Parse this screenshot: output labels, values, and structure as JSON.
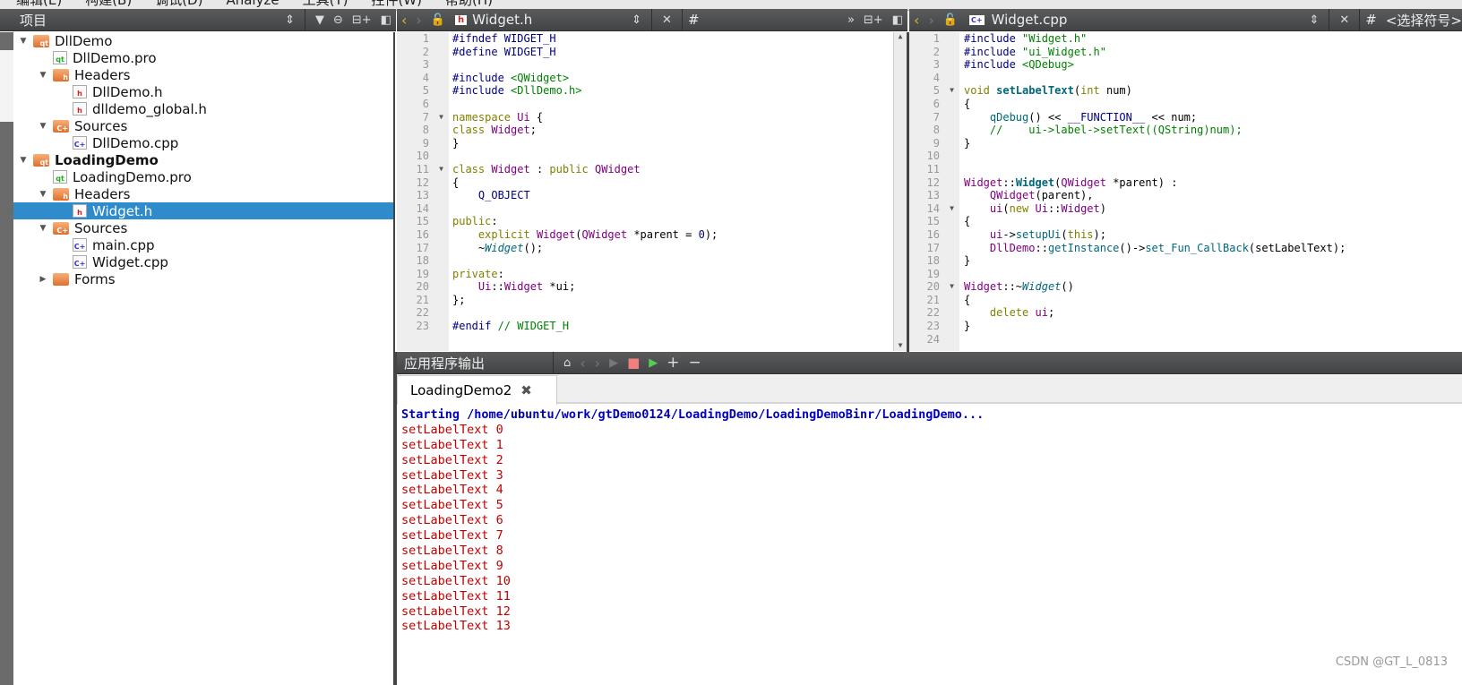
{
  "menu": [
    "编辑(E)",
    "构建(B)",
    "调试(D)",
    "Analyze",
    "工具(T)",
    "控件(W)",
    "帮助(H)"
  ],
  "projects": {
    "title": "项目",
    "tree": [
      {
        "label": "DllDemo",
        "depth": 0,
        "kind": "project",
        "expanded": true,
        "bold": false
      },
      {
        "label": "DllDemo.pro",
        "depth": 1,
        "kind": "pro"
      },
      {
        "label": "Headers",
        "depth": 1,
        "kind": "folder-h",
        "expanded": true
      },
      {
        "label": "DllDemo.h",
        "depth": 2,
        "kind": "h"
      },
      {
        "label": "dlldemo_global.h",
        "depth": 2,
        "kind": "h"
      },
      {
        "label": "Sources",
        "depth": 1,
        "kind": "folder-cpp",
        "expanded": true
      },
      {
        "label": "DllDemo.cpp",
        "depth": 2,
        "kind": "cpp"
      },
      {
        "label": "LoadingDemo",
        "depth": 0,
        "kind": "project",
        "expanded": true,
        "bold": true
      },
      {
        "label": "LoadingDemo.pro",
        "depth": 1,
        "kind": "pro"
      },
      {
        "label": "Headers",
        "depth": 1,
        "kind": "folder-h",
        "expanded": true
      },
      {
        "label": "Widget.h",
        "depth": 2,
        "kind": "h",
        "selected": true
      },
      {
        "label": "Sources",
        "depth": 1,
        "kind": "folder-cpp",
        "expanded": true
      },
      {
        "label": "main.cpp",
        "depth": 2,
        "kind": "cpp"
      },
      {
        "label": "Widget.cpp",
        "depth": 2,
        "kind": "cpp"
      },
      {
        "label": "Forms",
        "depth": 1,
        "kind": "folder-ui",
        "expanded": false
      }
    ]
  },
  "editor_left": {
    "file": "Widget.h",
    "symbol": "#",
    "folds": [
      7,
      11
    ],
    "lines": [
      [
        [
          "p",
          "#ifndef WIDGET_H"
        ]
      ],
      [
        [
          "p",
          "#define WIDGET_H"
        ]
      ],
      [],
      [
        [
          "p",
          "#include "
        ],
        [
          "s",
          "<QWidget>"
        ]
      ],
      [
        [
          "p",
          "#include "
        ],
        [
          "s",
          "<DllDemo.h>"
        ]
      ],
      [],
      [
        [
          "k",
          "namespace "
        ],
        [
          "t",
          "Ui"
        ],
        [
          "n",
          " {"
        ]
      ],
      [
        [
          "k",
          "class "
        ],
        [
          "t",
          "Widget"
        ],
        [
          "n",
          ";"
        ]
      ],
      [
        [
          "n",
          "}"
        ]
      ],
      [],
      [
        [
          "k",
          "class "
        ],
        [
          "t",
          "Widget"
        ],
        [
          "n",
          " : "
        ],
        [
          "k",
          "public "
        ],
        [
          "t",
          "QWidget"
        ]
      ],
      [
        [
          "n",
          "{"
        ]
      ],
      [
        [
          "n",
          "    "
        ],
        [
          "m",
          "Q_OBJECT"
        ]
      ],
      [],
      [
        [
          "k",
          "public"
        ],
        [
          "n",
          ":"
        ]
      ],
      [
        [
          "n",
          "    "
        ],
        [
          "k",
          "explicit "
        ],
        [
          "t",
          "Widget"
        ],
        [
          "n",
          "("
        ],
        [
          "t",
          "QWidget"
        ],
        [
          "n",
          " *parent = "
        ],
        [
          "num",
          "0"
        ],
        [
          "n",
          ");"
        ]
      ],
      [
        [
          "n",
          "    ~"
        ],
        [
          "v",
          "Widget"
        ],
        [
          "n",
          "();"
        ]
      ],
      [],
      [
        [
          "k",
          "private"
        ],
        [
          "n",
          ":"
        ]
      ],
      [
        [
          "n",
          "    "
        ],
        [
          "t",
          "Ui"
        ],
        [
          "n",
          "::"
        ],
        [
          "t",
          "Widget"
        ],
        [
          "n",
          " *ui;"
        ]
      ],
      [
        [
          "n",
          "};"
        ]
      ],
      [],
      [
        [
          "p",
          "#endif "
        ],
        [
          "c",
          "// WIDGET_H"
        ]
      ]
    ]
  },
  "editor_right": {
    "file": "Widget.cpp",
    "symbol": "#",
    "symbol_placeholder": "<选择符号>",
    "folds": [
      5,
      14,
      20
    ],
    "lines": [
      [
        [
          "p",
          "#include "
        ],
        [
          "s",
          "\"Widget.h\""
        ]
      ],
      [
        [
          "p",
          "#include "
        ],
        [
          "s",
          "\"ui_Widget.h\""
        ]
      ],
      [
        [
          "p",
          "#include "
        ],
        [
          "s",
          "<QDebug>"
        ]
      ],
      [],
      [
        [
          "k",
          "void "
        ],
        [
          "f",
          "setLabelText"
        ],
        [
          "n",
          "("
        ],
        [
          "k",
          "int"
        ],
        [
          "n",
          " num)"
        ]
      ],
      [
        [
          "n",
          "{"
        ]
      ],
      [
        [
          "n",
          "    "
        ],
        [
          "fn",
          "qDebug"
        ],
        [
          "n",
          "() << "
        ],
        [
          "m",
          "__FUNCTION__"
        ],
        [
          "n",
          " << num;"
        ]
      ],
      [
        [
          "n",
          "    "
        ],
        [
          "c",
          "//    ui->label->setText((QString)num);"
        ]
      ],
      [
        [
          "n",
          "}"
        ]
      ],
      [],
      [],
      [
        [
          "t",
          "Widget"
        ],
        [
          "n",
          "::"
        ],
        [
          "f",
          "Widget"
        ],
        [
          "n",
          "("
        ],
        [
          "t",
          "QWidget"
        ],
        [
          "n",
          " *parent) :"
        ]
      ],
      [
        [
          "n",
          "    "
        ],
        [
          "t",
          "QWidget"
        ],
        [
          "n",
          "(parent),"
        ]
      ],
      [
        [
          "n",
          "    "
        ],
        [
          "t",
          "ui"
        ],
        [
          "n",
          "("
        ],
        [
          "k",
          "new "
        ],
        [
          "t",
          "Ui"
        ],
        [
          "n",
          "::"
        ],
        [
          "t",
          "Widget"
        ],
        [
          "n",
          ")"
        ]
      ],
      [
        [
          "n",
          "{"
        ]
      ],
      [
        [
          "n",
          "    "
        ],
        [
          "t",
          "ui"
        ],
        [
          "n",
          "->"
        ],
        [
          "fn",
          "setupUi"
        ],
        [
          "n",
          "("
        ],
        [
          "k",
          "this"
        ],
        [
          "n",
          ");"
        ]
      ],
      [
        [
          "n",
          "    "
        ],
        [
          "t",
          "DllDemo"
        ],
        [
          "n",
          "::"
        ],
        [
          "fn",
          "getInstance"
        ],
        [
          "n",
          "()->"
        ],
        [
          "fn",
          "set_Fun_CallBack"
        ],
        [
          "n",
          "(setLabelText);"
        ]
      ],
      [
        [
          "n",
          "}"
        ]
      ],
      [],
      [
        [
          "t",
          "Widget"
        ],
        [
          "n",
          "::~"
        ],
        [
          "v",
          "Widget"
        ],
        [
          "n",
          "()"
        ]
      ],
      [
        [
          "n",
          "{"
        ]
      ],
      [
        [
          "n",
          "    "
        ],
        [
          "k",
          "delete "
        ],
        [
          "t",
          "ui"
        ],
        [
          "n",
          ";"
        ]
      ],
      [
        [
          "n",
          "}"
        ]
      ],
      []
    ]
  },
  "output": {
    "title": "应用程序输出",
    "tab": "LoadingDemo2",
    "lines": [
      "Starting /home/ubuntu/work/gtDemo0124/LoadingDemo/LoadingDemoBinr/LoadingDemo...",
      "setLabelText 0",
      "setLabelText 1",
      "setLabelText 2",
      "setLabelText 3",
      "setLabelText 4",
      "setLabelText 5",
      "setLabelText 6",
      "setLabelText 7",
      "setLabelText 8",
      "setLabelText 9",
      "setLabelText 10",
      "setLabelText 11",
      "setLabelText 12",
      "setLabelText 13"
    ]
  },
  "watermark": "CSDN @GT_L_0813"
}
